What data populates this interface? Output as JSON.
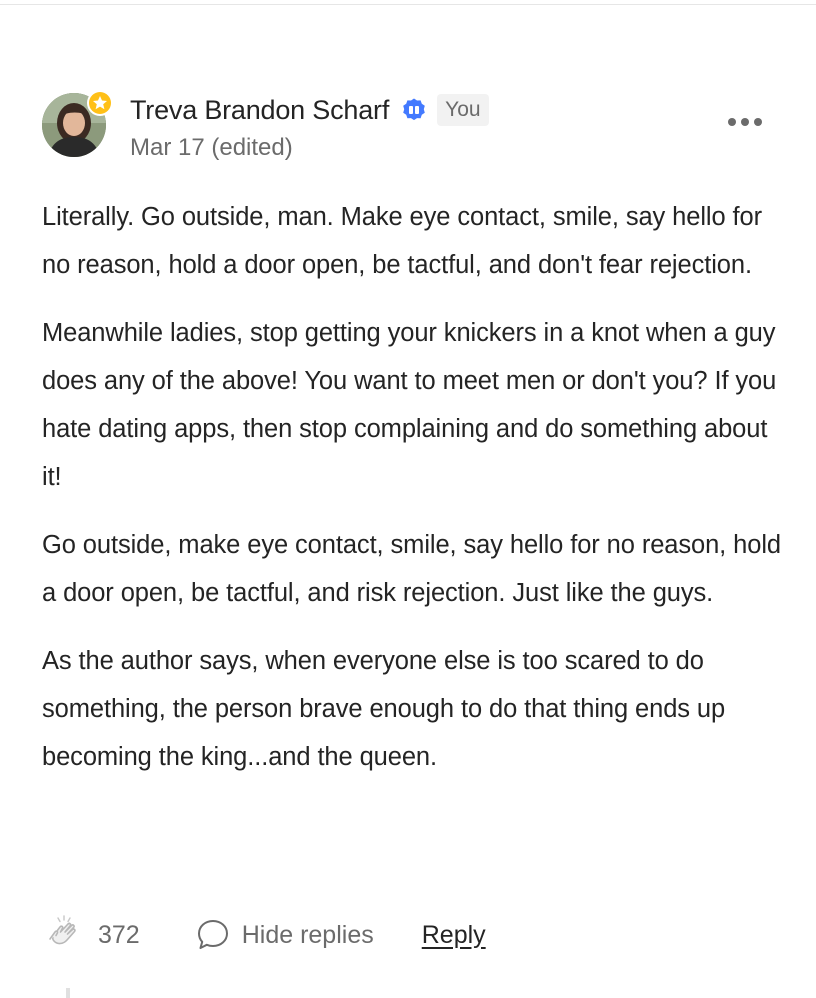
{
  "comment": {
    "author_name": "Treva Brandon Scharf",
    "you_badge": "You",
    "date": "Mar 17 (edited)",
    "icons": {
      "avatar": "author-photo",
      "member_badge": "member-star-icon",
      "verified": "verified-badge-icon",
      "more": "more-options-icon"
    },
    "paragraphs": [
      "Literally. Go outside, man. Make eye contact, smile, say hello for no reason, hold a door open, be tactful, and don't fear rejection.",
      "Meanwhile ladies, stop getting your knickers in a knot when a guy does any of the above! You want to meet men or don't you? If you hate dating apps, then stop complaining and do something about it!",
      "Go outside, make eye contact, smile, say hello for no reason, hold a door open, be tactful, and risk rejection. Just like the guys.",
      "As the author says, when everyone else is too scared to do something, the person brave enough to do that thing ends up becoming the king...and the queen."
    ],
    "actions": {
      "clap_count": "372",
      "hide_replies_label": "Hide replies",
      "reply_label": "Reply"
    }
  },
  "colors": {
    "text_primary": "#242424",
    "text_secondary": "#6b6b6b",
    "member_badge": "#ffc017",
    "verified_blue": "#437aff",
    "you_badge_bg": "#f2f2f2"
  }
}
